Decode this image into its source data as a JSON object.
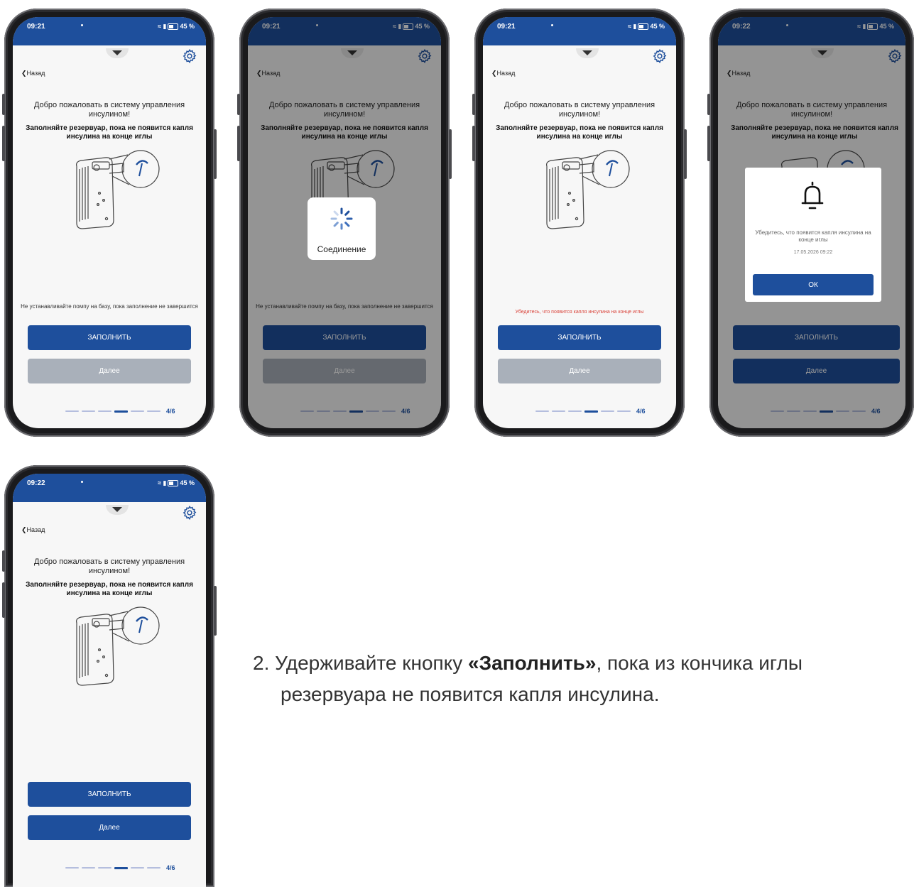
{
  "screens": [
    {
      "time": "09:21",
      "battery": "45 %",
      "back_label": "Назад",
      "welcome_text": "Добро пожаловать в систему управления инсулином!",
      "instruction_text": "Заполняйте резервуар, пока не появится капля инсулина на конце иглы",
      "note_text": "Не устанавливайте помпу на базу, пока заполнение не завершится",
      "fill_label": "ЗАПОЛНИТЬ",
      "next_label": "Далее",
      "progress_label": "4/6"
    },
    {
      "time": "09:21",
      "battery": "45 %",
      "back_label": "Назад",
      "welcome_text": "Добро пожаловать в систему управления инсулином!",
      "instruction_text": "Заполняйте резервуар, пока не появится капля инсулина на конце иглы",
      "note_text": "Не устанавливайте помпу на базу, пока заполнение не завершится",
      "fill_label": "ЗАПОЛНИТЬ",
      "next_label": "Далее",
      "progress_label": "4/6",
      "loader_label": "Соединение"
    },
    {
      "time": "09:21",
      "battery": "45 %",
      "back_label": "Назад",
      "welcome_text": "Добро пожаловать в систему управления инсулином!",
      "instruction_text": "Заполняйте резервуар, пока не появится капля инсулина на конце иглы",
      "warning_text": "Убедитесь, что появится капля инсулина на конце иглы",
      "fill_label": "ЗАПОЛНИТЬ",
      "next_label": "Далее",
      "progress_label": "4/6"
    },
    {
      "time": "09:22",
      "battery": "45 %",
      "back_label": "Назад",
      "welcome_text": "Добро пожаловать в систему управления инсулином!",
      "instruction_text": "Заполняйте резервуар, пока не появится капля инсулина на конце иглы",
      "fill_label": "ЗАПОЛНИТЬ",
      "next_label": "Далее",
      "progress_label": "4/6",
      "dialog": {
        "message": "Убедитесь, что появится капля инсулина на конце иглы",
        "datetime": "17.05.2026 09:22",
        "ok_label": "ОК"
      }
    },
    {
      "time": "09:22",
      "battery": "45 %",
      "back_label": "Назад",
      "welcome_text": "Добро пожаловать в систему управления инсулином!",
      "instruction_text": "Заполняйте резервуар, пока не появится капля инсулина на конце иглы",
      "fill_label": "ЗАПОЛНИТЬ",
      "next_label": "Далее",
      "progress_label": "4/6"
    }
  ],
  "progress": {
    "current_step": 4,
    "total_steps": 6
  },
  "caption": {
    "number": "2.",
    "text_before": "Удерживайте кнопку ",
    "bold_text": "«Заполнить»",
    "text_after": ", пока из кончика иглы",
    "line2": "резервуара не появится капля инсулина."
  },
  "colors": {
    "primary": "#1e4f9c",
    "warning": "#d9433a",
    "disabled": "#a9b0ba",
    "progress_inactive": "#b5bede"
  }
}
